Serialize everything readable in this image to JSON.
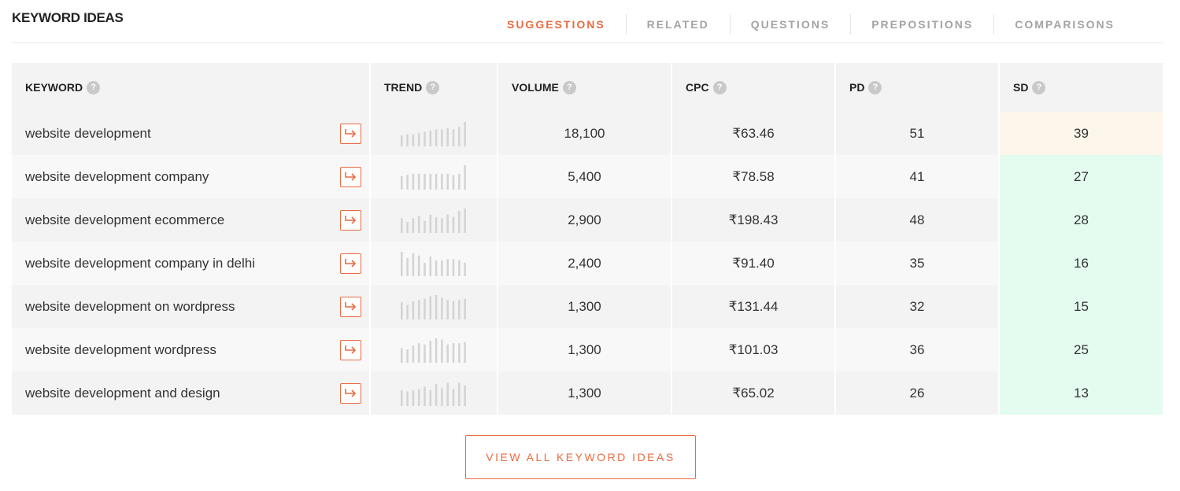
{
  "title": "KEYWORD IDEAS",
  "tabs": [
    {
      "label": "SUGGESTIONS",
      "active": true
    },
    {
      "label": "RELATED",
      "active": false
    },
    {
      "label": "QUESTIONS",
      "active": false
    },
    {
      "label": "PREPOSITIONS",
      "active": false
    },
    {
      "label": "COMPARISONS",
      "active": false
    }
  ],
  "table": {
    "headers": [
      "KEYWORD",
      "TREND",
      "VOLUME",
      "CPC",
      "PD",
      "SD"
    ],
    "rows": [
      {
        "keyword": "website development",
        "volume": "18,100",
        "cpc": "₹63.46",
        "pd": "51",
        "sd": "39",
        "sd_level": "medium",
        "trend": [
          0.45,
          0.5,
          0.5,
          0.55,
          0.6,
          0.65,
          0.7,
          0.7,
          0.75,
          0.7,
          0.8,
          1.0
        ]
      },
      {
        "keyword": "website development company",
        "volume": "5,400",
        "cpc": "₹78.58",
        "pd": "41",
        "sd": "27",
        "sd_level": "easy",
        "trend": [
          0.55,
          0.6,
          0.65,
          0.65,
          0.65,
          0.65,
          0.65,
          0.65,
          0.65,
          0.6,
          0.65,
          1.0
        ]
      },
      {
        "keyword": "website development ecommerce",
        "volume": "2,900",
        "cpc": "₹198.43",
        "pd": "48",
        "sd": "28",
        "sd_level": "easy",
        "trend": [
          0.6,
          0.45,
          0.6,
          0.7,
          0.5,
          0.75,
          0.65,
          0.6,
          0.75,
          0.65,
          0.9,
          1.0
        ]
      },
      {
        "keyword": "website development company in delhi",
        "volume": "2,400",
        "cpc": "₹91.40",
        "pd": "35",
        "sd": "16",
        "sd_level": "easy",
        "trend": [
          1.0,
          0.75,
          0.95,
          0.85,
          0.55,
          0.8,
          0.65,
          0.65,
          0.7,
          0.7,
          0.65,
          0.55
        ]
      },
      {
        "keyword": "website development on wordpress",
        "volume": "1,300",
        "cpc": "₹131.44",
        "pd": "32",
        "sd": "15",
        "sd_level": "easy",
        "trend": [
          0.7,
          0.6,
          0.75,
          0.8,
          0.85,
          0.95,
          1.0,
          0.9,
          0.8,
          0.75,
          0.8,
          0.85
        ]
      },
      {
        "keyword": "website development wordpress",
        "volume": "1,300",
        "cpc": "₹101.03",
        "pd": "36",
        "sd": "25",
        "sd_level": "easy",
        "trend": [
          0.6,
          0.55,
          0.7,
          0.8,
          0.75,
          0.9,
          1.0,
          0.95,
          0.75,
          0.8,
          0.8,
          0.85
        ]
      },
      {
        "keyword": "website development and design",
        "volume": "1,300",
        "cpc": "₹65.02",
        "pd": "26",
        "sd": "13",
        "sd_level": "easy",
        "trend": [
          0.65,
          0.6,
          0.65,
          0.7,
          0.8,
          0.65,
          0.9,
          0.75,
          0.95,
          0.7,
          0.95,
          0.85
        ]
      }
    ]
  },
  "view_all_label": "VIEW ALL KEYWORD IDEAS",
  "icons": {
    "help": "help-circle-icon",
    "go": "arrow-right-corner-icon"
  },
  "colors": {
    "accent": "#ea6b41",
    "sd_easy_bg": "#e4fbef",
    "sd_medium_bg": "#fdf6ea",
    "trend_bar": "#d4d4d4"
  }
}
